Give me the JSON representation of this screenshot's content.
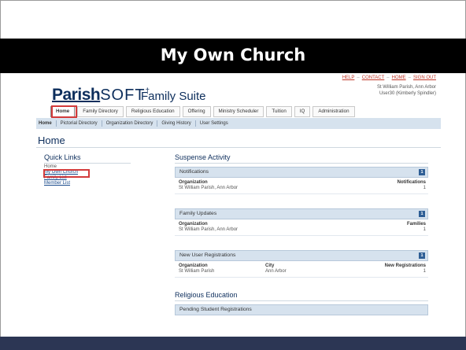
{
  "slide": {
    "title": "My Own Church"
  },
  "app": {
    "logo_parish": "Parish",
    "logo_soft": "SOFT",
    "logo_mark": "†",
    "suite_name": "Family Suite",
    "top_links": [
      "HELP",
      "CONTACT",
      "HOME",
      "SIGN OUT"
    ],
    "top_link_separator": "–",
    "user_parish": "St William Parish, Ann Arbor",
    "user_name": "User30 (Kimberly Spindler)"
  },
  "tabs": [
    {
      "label": "Home",
      "active": true
    },
    {
      "label": "Family Directory"
    },
    {
      "label": "Religious Education"
    },
    {
      "label": "Offering"
    },
    {
      "label": "Ministry Scheduler"
    },
    {
      "label": "Tuition"
    },
    {
      "label": "IQ"
    },
    {
      "label": "Administration"
    }
  ],
  "subnav": [
    "Home",
    "Pictorial Directory",
    "Organization Directory",
    "Giving History",
    "User Settings"
  ],
  "page": {
    "heading": "Home"
  },
  "quick_links": {
    "title": "Quick Links",
    "items": [
      "Home",
      "My Own Church",
      "Family List",
      "Member List"
    ]
  },
  "suspense": {
    "title": "Suspense Activity",
    "notifications": {
      "title": "Notifications",
      "badge": "1",
      "col1_label": "Organization",
      "col1_value": "St William Parish, Ann Arbor",
      "col2_label": "Notifications",
      "col2_value": "1"
    },
    "family_updates": {
      "title": "Family Updates",
      "badge": "1",
      "col1_label": "Organization",
      "col1_value": "St William Parish, Ann Arbor",
      "col2_label": "Families",
      "col2_value": "1"
    },
    "new_user_registrations": {
      "title": "New User Registrations",
      "badge": "1",
      "col1_label": "Organization",
      "col1_value": "St William Parish",
      "col_mid_label": "City",
      "col_mid_value": "Ann Arbor",
      "col2_label": "New Registrations",
      "col2_value": "1"
    }
  },
  "religious_education": {
    "title": "Religious Education",
    "pending": "Pending Student Registrations"
  },
  "colors": {
    "highlight": "#d33b3b",
    "brand_navy": "#0d2e5c",
    "panel_header": "#d6e2ee",
    "badge": "#2e5e95",
    "bottom_bar": "#2c3654"
  }
}
